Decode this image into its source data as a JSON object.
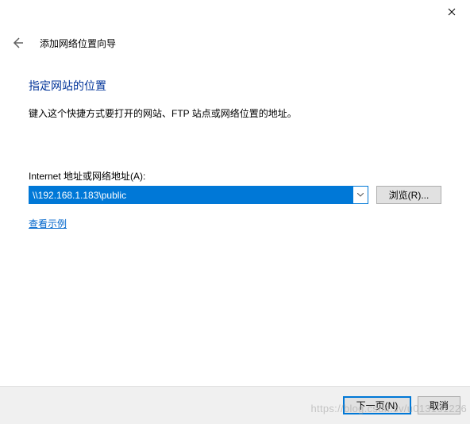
{
  "window": {
    "close_tooltip": "关闭"
  },
  "header": {
    "wizard_title": "添加网络位置向导"
  },
  "main": {
    "heading": "指定网站的位置",
    "description": "键入这个快捷方式要打开的网站、FTP 站点或网络位置的地址。",
    "address_label": "Internet 地址或网络地址(A):",
    "address_value": "\\\\192.168.1.183\\public",
    "browse_label": "浏览(R)...",
    "example_link": "查看示例"
  },
  "footer": {
    "next_label": "下一页(N)",
    "cancel_label": "取消"
  },
  "watermark": "https://blog.csdn.sv/u013131226"
}
